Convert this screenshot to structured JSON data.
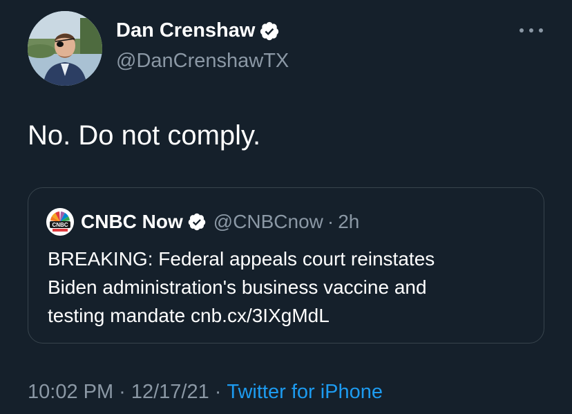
{
  "author": {
    "name": "Dan Crenshaw",
    "handle": "@DanCrenshawTX",
    "verified": true,
    "avatar_icon": "profile-photo"
  },
  "more_icon": "more-options-icon",
  "tweet": {
    "text": "No. Do not comply."
  },
  "quoted": {
    "name": "CNBC Now",
    "handle": "@CNBCnow",
    "dot": "·",
    "time": "2h",
    "verified": true,
    "logo_icon": "cnbc-peacock-icon",
    "body_lines": [
      "BREAKING: Federal appeals court reinstates",
      "Biden administration's business vaccine and",
      "testing mandate cnb.cx/3IXgMdL"
    ]
  },
  "meta": {
    "time": "10:02 PM",
    "sep1": "·",
    "date": "12/17/21",
    "sep2": "·",
    "source": "Twitter for iPhone"
  },
  "colors": {
    "background": "#15202b",
    "text": "#ffffff",
    "secondary": "#8b98a5",
    "link": "#1d9bf0",
    "border": "#38444d"
  }
}
